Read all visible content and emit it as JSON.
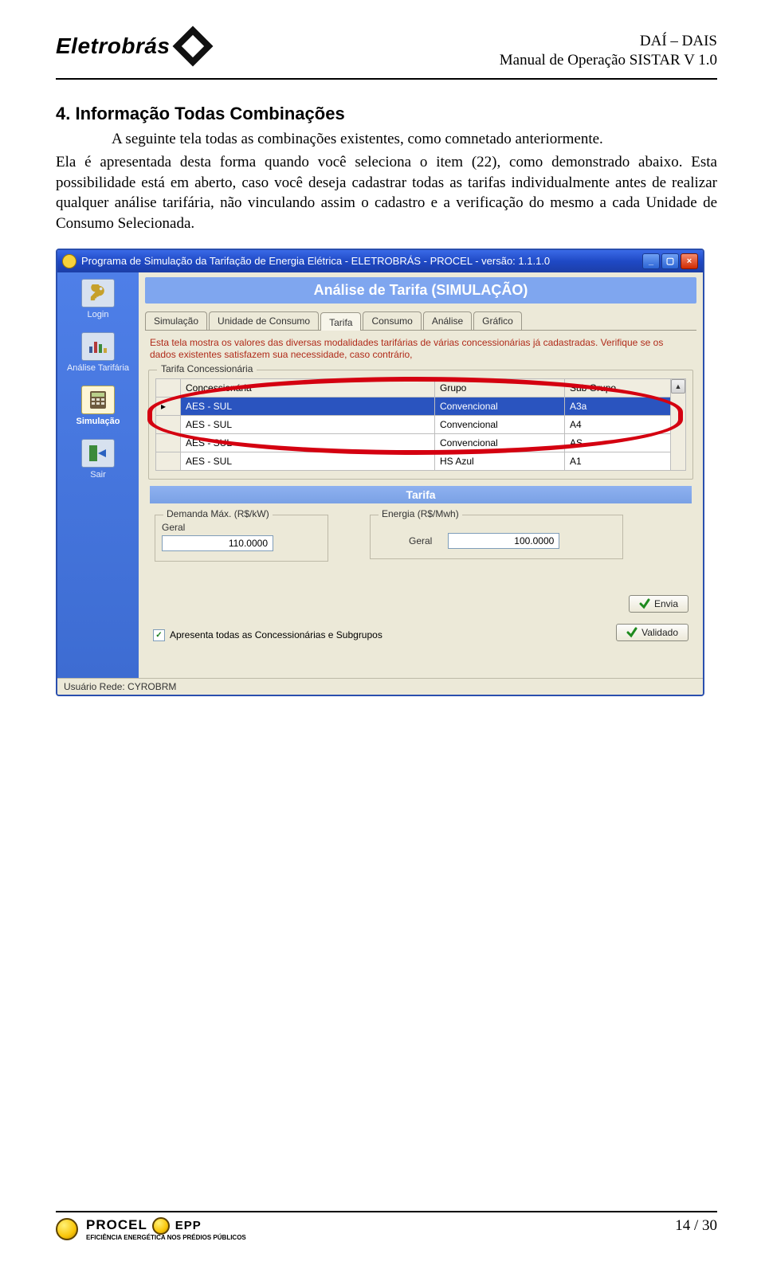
{
  "header": {
    "logo_text": "Eletrobrás",
    "right1": "DAÍ – DAIS",
    "right2": "Manual de Operação SISTAR V 1.0"
  },
  "section": {
    "title": "4. Informação Todas Combinações",
    "para_line1": "A seguinte tela todas as combinações existentes, como comnetado anteriormente.",
    "para_rest": "Ela é apresentada desta forma quando você seleciona o item (22), como demonstrado abaixo. Esta possibilidade está em aberto, caso você deseja cadastrar todas as tarifas individualmente antes de realizar qualquer análise tarifária, não vinculando assim o cadastro e a verificação do mesmo a cada Unidade de Consumo Selecionada."
  },
  "app": {
    "title": "Programa de Simulação da Tarifação de Energia Elétrica - ELETROBRÁS - PROCEL - versão: 1.1.1.0",
    "sidebar": [
      {
        "label": "Login"
      },
      {
        "label": "Análise Tarifária"
      },
      {
        "label": "Simulação"
      },
      {
        "label": "Sair"
      }
    ],
    "main_title": "Análise de Tarifa (SIMULAÇÃO)",
    "tabs": [
      "Simulação",
      "Unidade de Consumo",
      "Tarifa",
      "Consumo",
      "Análise",
      "Gráfico"
    ],
    "active_tab_index": 2,
    "help_text": "Esta tela mostra os valores das diversas modalidades tarifárias de várias concessionárias já cadastradas. Verifique se os dados existentes satisfazem sua necessidade, caso contrário,",
    "grid": {
      "legend": "Tarifa Concessionária",
      "headers": [
        "Concessionária",
        "Grupo",
        "Sub Grupo"
      ],
      "rows": [
        {
          "c": "AES - SUL",
          "g": "Convencional",
          "s": "A3a",
          "selected": true
        },
        {
          "c": "AES - SUL",
          "g": "Convencional",
          "s": "A4"
        },
        {
          "c": "AES - SUL",
          "g": "Convencional",
          "s": "AS"
        },
        {
          "c": "AES - SUL",
          "g": "HS Azul",
          "s": "A1"
        }
      ]
    },
    "tarifa": {
      "header": "Tarifa",
      "demanda_legend": "Demanda Máx. (R$/kW)",
      "demanda_label": "Geral",
      "demanda_value": "110.0000",
      "energia_legend": "Energia (R$/Mwh)",
      "energia_label": "Geral",
      "energia_value": "100.0000"
    },
    "checkbox_label": "Apresenta todas as Concessionárias e Subgrupos",
    "btn_envia": "Envia",
    "btn_validado": "Validado",
    "statusbar": "Usuário Rede: CYROBRM"
  },
  "footer": {
    "procel_name": "PROCEL",
    "procel_epp": "EPP",
    "procel_tag": "EFICIÊNCIA ENERGÉTICA NOS PRÉDIOS PÚBLICOS",
    "page": "14 / 30"
  }
}
